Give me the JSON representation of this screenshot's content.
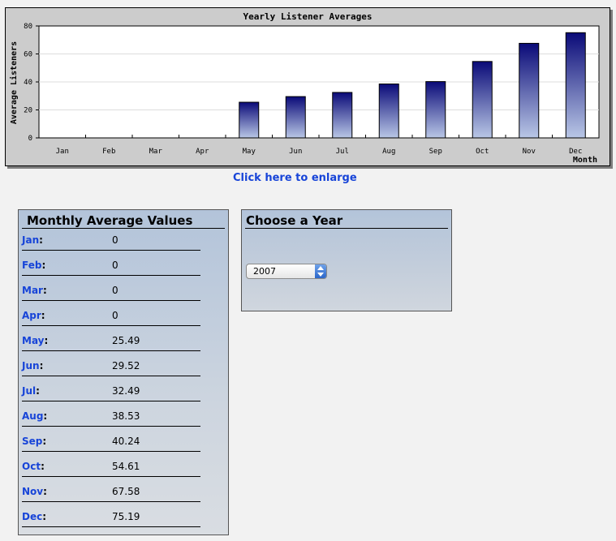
{
  "chart_data": {
    "type": "bar",
    "title": "Yearly Listener Averages",
    "ylabel": "Average Listeners",
    "xlabel": "Month",
    "categories": [
      "Jan",
      "Feb",
      "Mar",
      "Apr",
      "May",
      "Jun",
      "Jul",
      "Aug",
      "Sep",
      "Oct",
      "Nov",
      "Dec"
    ],
    "values": [
      0,
      0,
      0,
      0,
      25.49,
      29.52,
      32.49,
      38.53,
      40.24,
      54.61,
      67.58,
      75.19
    ],
    "ylim": [
      0,
      80
    ],
    "yticks": [
      0,
      20,
      40,
      60,
      80
    ],
    "grid": true,
    "bar_color_top": "#0a0a78",
    "bar_color_bottom": "#b9c7e6"
  },
  "enlarge_link": "Click here to enlarge",
  "monthly": {
    "title": "Monthly Average Values",
    "rows": [
      {
        "label": "Jan",
        "value": "0"
      },
      {
        "label": "Feb",
        "value": "0"
      },
      {
        "label": "Mar",
        "value": "0"
      },
      {
        "label": "Apr",
        "value": "0"
      },
      {
        "label": "May",
        "value": "25.49"
      },
      {
        "label": "Jun",
        "value": "29.52"
      },
      {
        "label": "Jul",
        "value": "32.49"
      },
      {
        "label": "Aug",
        "value": "38.53"
      },
      {
        "label": "Sep",
        "value": "40.24"
      },
      {
        "label": "Oct",
        "value": "54.61"
      },
      {
        "label": "Nov",
        "value": "67.58"
      },
      {
        "label": "Dec",
        "value": "75.19"
      }
    ]
  },
  "year_chooser": {
    "title": "Choose a Year",
    "selected": "2007",
    "icon": "select-arrows-icon"
  },
  "colors": {
    "link": "#1744d8",
    "panel_gradient_top": "#b3c4da",
    "chart_frame": "#cccccc"
  }
}
